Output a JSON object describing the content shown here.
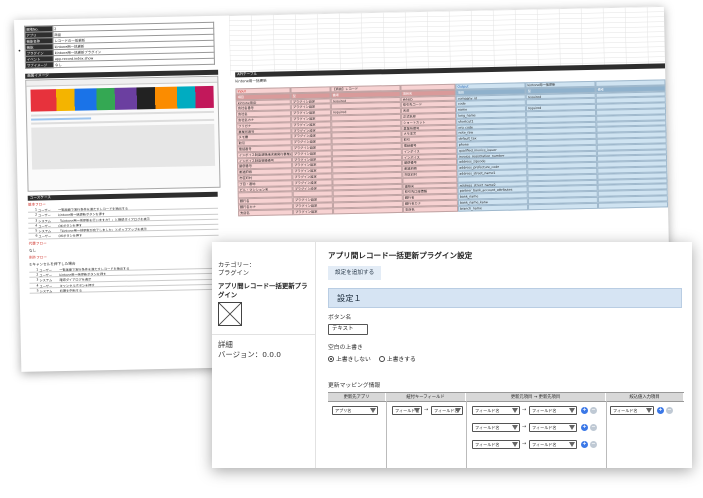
{
  "sheet": {
    "meta_rows": [
      {
        "k": "現地No.",
        "v": "2"
      },
      {
        "k": "アプリ",
        "v": "商談"
      },
      {
        "k": "機能名称",
        "v": "レコードの一括更新"
      },
      {
        "k": "機能",
        "v": "kintone用一括更新"
      },
      {
        "k": "プラグイン",
        "v": "kintone用一括更新プラグイン"
      },
      {
        "k": "イベント",
        "v": "app.record.index.show"
      },
      {
        "k": "サブイメージ",
        "v": "なし"
      }
    ],
    "screen_title": "画面イメージ",
    "usecase_title": "ユースケース",
    "usecase_subtitle": "基本フロー",
    "usecase_rows": [
      {
        "n": "1",
        "w": "ユーザー",
        "t": "一覧画面で実行条件を満たすレコードを抽出する"
      },
      {
        "n": "2",
        "w": "ユーザー",
        "t": "kintone用一括更新ボタンを押す"
      },
      {
        "n": "3",
        "w": "システム",
        "t": "「kintone用一括更新を行いますか？」と確認ダイアログを表示"
      },
      {
        "n": "4",
        "w": "ユーザー",
        "t": "OKボタンを押す"
      },
      {
        "n": "5",
        "w": "システム",
        "t": "「kintone用一括更新が完了しました」とポップアップを表示"
      },
      {
        "n": "6",
        "w": "ユーザー",
        "t": "OKボタンを押す"
      }
    ],
    "alt_title": "代替フロー",
    "alt_none": "なし",
    "exc_title": "例外フロー",
    "exc_sub": "①キャンセルを押下した場合",
    "exc_rows": [
      {
        "n": "1",
        "w": "ユーザー",
        "t": "一覧画面で実行条件を満たすレコードを抽出する"
      },
      {
        "n": "2",
        "w": "ユーザー",
        "t": "kintone用一括更新ボタンを押す"
      },
      {
        "n": "3",
        "w": "システム",
        "t": "確認ダイアログを表示"
      },
      {
        "n": "4",
        "w": "ユーザー",
        "t": "キャンセルボタンを押す"
      },
      {
        "n": "5",
        "w": "システム",
        "t": "処理を中断する"
      }
    ],
    "api_title": "APIテーブル",
    "api_sub_label": "kintone用一括更新",
    "input_label": "Input",
    "input_value": "【商談】レコード",
    "output_label": "Output",
    "output_value": "kintone用一括更新",
    "api_headers": [
      "項目",
      "型",
      "備考",
      "項目名",
      "項目",
      "型",
      "備考"
    ],
    "api_rows": [
      [
        "kintone用ID",
        "プラグイン設定",
        "required",
        "会社ID",
        "company_id",
        "required",
        ""
      ],
      [
        "会社名番号",
        "プラグイン設定",
        "",
        "取引先コード",
        "code",
        "",
        ""
      ],
      [
        "会社名",
        "プラグイン設定",
        "required",
        "名前",
        "name",
        "required",
        ""
      ],
      [
        "会社名カナ",
        "プラグイン設定",
        "",
        "正式名称",
        "long_name",
        "",
        ""
      ],
      [
        "フリガナ",
        "プラグイン設定",
        "",
        "ショートカット",
        "shortcut1",
        "",
        ""
      ],
      [
        "事業所番号",
        "プラグイン設定",
        "",
        "事業所番号",
        "org_code",
        "",
        ""
      ],
      [
        "メモ欄",
        "プラグイン設定",
        "",
        "メモ本文",
        "note_raw",
        "",
        ""
      ],
      [
        "取引",
        "プラグイン設定",
        "",
        "取引",
        "default_tax",
        "",
        ""
      ],
      [
        "電話番号",
        "プラグイン設定",
        "",
        "電話番号",
        "phone",
        "",
        ""
      ],
      [
        "インボイス制度適格請求書発行事業者",
        "プラグイン設定",
        "",
        "インボイス",
        "qualified_invoice_issuer",
        "",
        ""
      ],
      [
        "インボイス制度登録番号",
        "プラグイン設定",
        "",
        "インボイス",
        "invoice_registration_number",
        "",
        ""
      ],
      [
        "郵便番号",
        "プラグイン設定",
        "",
        "郵便番号",
        "address_zipcode",
        "",
        ""
      ],
      [
        "都道府県",
        "プラグイン設定",
        "",
        "都道府県",
        "address_prefecture_code",
        "",
        ""
      ],
      [
        "市区町村",
        "プラグイン設定",
        "",
        "市区町村",
        "address_street_name1",
        "",
        ""
      ],
      [
        "丁目・番地",
        "プラグイン設定",
        "",
        "",
        "",
        "",
        ""
      ],
      [
        "ビル・マンション名",
        "プラグイン設定",
        "",
        "建物名",
        "address_street_name2",
        "",
        ""
      ],
      [
        "",
        "",
        "",
        "取引先口座情報",
        "partner_bank_account_attributes",
        "",
        ""
      ],
      [
        "銀行名",
        "プラグイン設定",
        "",
        "銀行名",
        "bank_name",
        "",
        ""
      ],
      [
        "銀行名カナ",
        "プラグイン設定",
        "",
        "銀行名カナ",
        "bank_name_kana",
        "",
        ""
      ],
      [
        "支店名",
        "プラグイン設定",
        "",
        "支店名",
        "branch_name",
        "",
        ""
      ]
    ]
  },
  "card": {
    "category_label": "カテゴリー：",
    "category_value": "プラグイン",
    "plugin_name": "アプリ間レコード一括更新プラグイン",
    "detail_label": "詳細",
    "version_text": "バージョン：0.0.0",
    "title": "アプリ間レコード一括更新プラグイン設定",
    "add_setting_button": "設定を追加する",
    "setting_header": "設定１",
    "button_name_label": "ボタン名",
    "button_name_value": "テキスト",
    "overwrite_label": "空白の上書き",
    "radio_no_overwrite": "上書きしない",
    "radio_overwrite": "上書きする",
    "mapping_label": "更新マッピング情報",
    "mapping_headers": [
      "更新先アプリ",
      "紐付キーフィールド",
      "更新元項目 → 更新先項目",
      "絞込値入力項目"
    ],
    "app_select": "アプリ名",
    "field_select": "フィールド名",
    "arrow": "→",
    "plus": "+",
    "minus": "−"
  }
}
